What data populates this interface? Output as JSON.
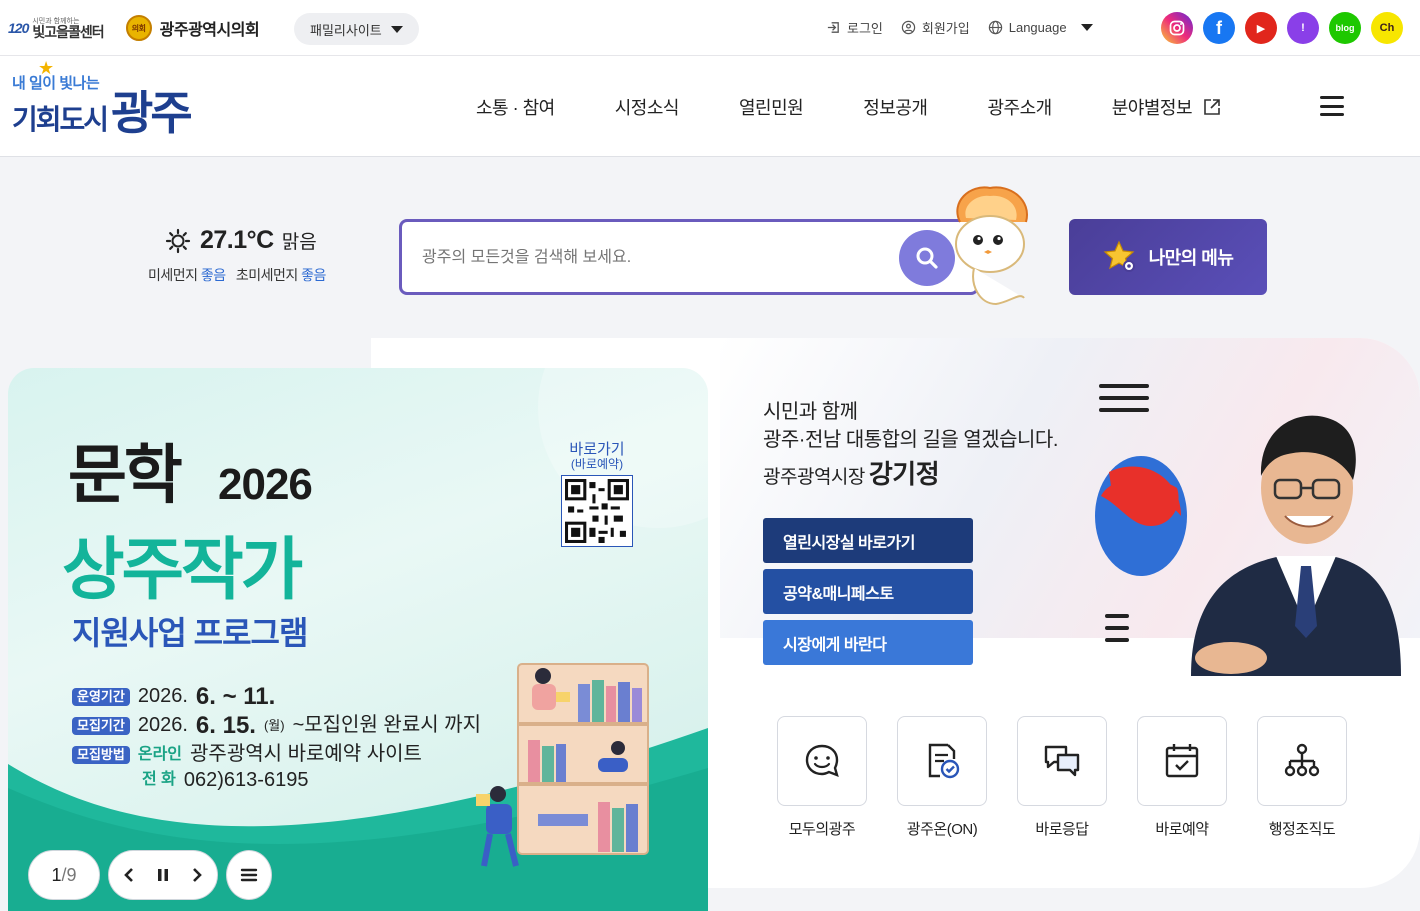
{
  "util": {
    "center_logo_small": "시민과 함께하는",
    "center_logo_num": "120",
    "center_logo_text": "빛고을콜센터",
    "council_seal": "의회",
    "council_name": "광주광역시의회",
    "family_site": "패밀리사이트",
    "login": "로그인",
    "signup": "회원가입",
    "language": "Language",
    "sns": [
      {
        "name": "instagram",
        "glyph": "",
        "color": "#dd2a7b"
      },
      {
        "name": "facebook",
        "glyph": "f",
        "color": "#1877f2"
      },
      {
        "name": "youtube",
        "glyph": "▶",
        "color": "#e1261c"
      },
      {
        "name": "post",
        "glyph": "!",
        "color": "#8a3fe8"
      },
      {
        "name": "blog",
        "glyph": "blog",
        "color": "#1ec800"
      },
      {
        "name": "kakao-channel",
        "glyph": "Ch",
        "color": "#f7e600"
      }
    ]
  },
  "gnb": {
    "slogan_top": "내 일이 빛나는",
    "slogan_a": "기회도시",
    "slogan_b": "광주",
    "menu": [
      "소통 · 참여",
      "시정소식",
      "열린민원",
      "정보공개",
      "광주소개",
      "분야별정보"
    ]
  },
  "weather": {
    "temp": "27.1°C",
    "condition": "맑음",
    "dust_label": "미세먼지",
    "dust_value": "좋음",
    "fine_dust_label": "초미세먼지",
    "fine_dust_value": "좋음"
  },
  "search": {
    "placeholder": "광주의 모든것을 검색해 보세요."
  },
  "my_menu": "나만의 메뉴",
  "mayor": {
    "line1": "시민과 함께",
    "line2": "광주·전남 대통합의 길을 열겠습니다.",
    "title": "광주광역시장",
    "name": "강기정",
    "buttons": [
      "열린시장실 바로가기",
      "공약&매니페스토",
      "시장에게 바란다"
    ]
  },
  "quick_links": [
    "모두의광주",
    "광주온(ON)",
    "바로응답",
    "바로예약",
    "행정조직도"
  ],
  "banner": {
    "title1": "문학",
    "year": "2026",
    "title2": "상주작가",
    "title3": "지원사업 프로그램",
    "qr_label1": "바로가기",
    "qr_label2": "(바로예약)",
    "run_tag": "운영기간",
    "run_date_prefix": "2026.",
    "run_date_big": "6. ~ 11.",
    "recruit_tag": "모집기간",
    "recruit_prefix": "2026.",
    "recruit_big": "6. 15.",
    "recruit_day": "(월)",
    "recruit_suffix": "~모집인원 완료시 까지",
    "method_tag": "모집방법",
    "online_kw": "온라인",
    "online_text": "광주광역시 바로예약 사이트",
    "phone_kw": "전  화",
    "phone_text": "062)613-6195",
    "page_current": "1",
    "page_total": "/9"
  }
}
